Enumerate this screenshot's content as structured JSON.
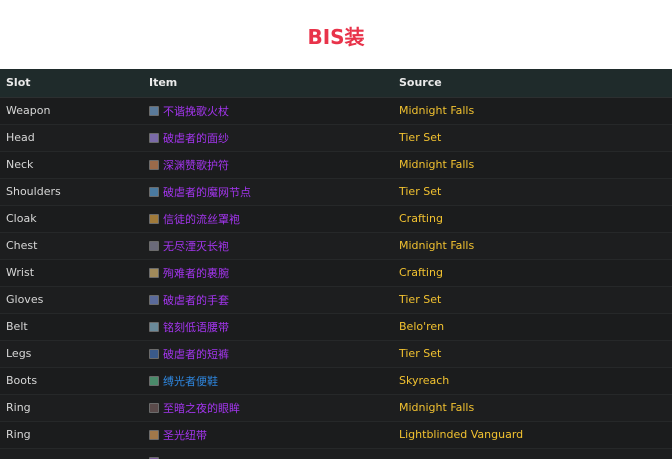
{
  "page": {
    "title": "BIS装"
  },
  "table": {
    "headers": [
      "Slot",
      "Item",
      "Source"
    ],
    "rows": [
      {
        "slot": "Weapon",
        "item": "不谐挽歌火杖",
        "source": "Midnight Falls",
        "quality": "epic",
        "icon_color": "#5a7a9a"
      },
      {
        "slot": "Head",
        "item": "破虐者的面纱",
        "source": "Tier Set",
        "quality": "epic",
        "icon_color": "#7a6aa8"
      },
      {
        "slot": "Neck",
        "item": "深渊赞歌护符",
        "source": "Midnight Falls",
        "quality": "epic",
        "icon_color": "#9a6a4a"
      },
      {
        "slot": "Shoulders",
        "item": "破虐者的魔网节点",
        "source": "Tier Set",
        "quality": "epic",
        "icon_color": "#4a7aa0"
      },
      {
        "slot": "Cloak",
        "item": "信徒的流丝罩袍",
        "source": "Crafting",
        "quality": "epic",
        "icon_color": "#a07a3a"
      },
      {
        "slot": "Chest",
        "item": "无尽湮灭长袍",
        "source": "Midnight Falls",
        "quality": "epic",
        "icon_color": "#6a6a7a"
      },
      {
        "slot": "Wrist",
        "item": "殉难者的裹腕",
        "source": "Crafting",
        "quality": "epic",
        "icon_color": "#a08a5a"
      },
      {
        "slot": "Gloves",
        "item": "破虐者的手套",
        "source": "Tier Set",
        "quality": "epic",
        "icon_color": "#5a6a9a"
      },
      {
        "slot": "Belt",
        "item": "铭刻低语腰带",
        "source": "Belo'ren",
        "quality": "epic",
        "icon_color": "#6a8a9a"
      },
      {
        "slot": "Legs",
        "item": "破虐者的短裤",
        "source": "Tier Set",
        "quality": "epic",
        "icon_color": "#3a5a8a"
      },
      {
        "slot": "Boots",
        "item": "缚光者便鞋",
        "source": "Skyreach",
        "quality": "rare",
        "icon_color": "#4a8a6a"
      },
      {
        "slot": "Ring",
        "item": "至暗之夜的眼眸",
        "source": "Midnight Falls",
        "quality": "epic",
        "icon_color": "#5a4a4a"
      },
      {
        "slot": "Ring",
        "item": "圣光纽带",
        "source": "Lightblinded Vanguard",
        "quality": "epic",
        "icon_color": "#a0784a"
      },
      {
        "slot": "",
        "item": "",
        "source": "",
        "quality": "epic",
        "icon_color": "#7a5a9a"
      }
    ]
  }
}
